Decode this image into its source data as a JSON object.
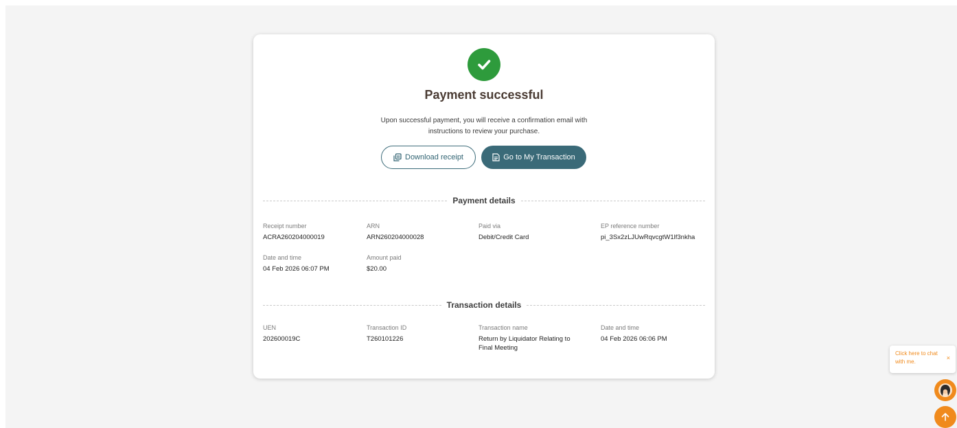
{
  "header": {
    "title": "Payment successful",
    "message": "Upon successful payment, you will receive a confirmation email with instructions to review your purchase."
  },
  "actions": {
    "download_label": "Download receipt",
    "transaction_label": "Go to My Transaction"
  },
  "payment_details": {
    "heading": "Payment details",
    "receipt_number": {
      "label": "Receipt number",
      "value": "ACRA260204000019"
    },
    "arn": {
      "label": "ARN",
      "value": "ARN260204000028"
    },
    "paid_via": {
      "label": "Paid via",
      "value": "Debit/Credit Card"
    },
    "ep_reference": {
      "label": "EP reference number",
      "value": "pi_3Sx2zLJUwRqvcgtW1lf3nkha"
    },
    "date_time": {
      "label": "Date and time",
      "value": "04 Feb 2026 06:07 PM"
    },
    "amount_paid": {
      "label": "Amount paid",
      "value": "$20.00"
    }
  },
  "transaction_details": {
    "heading": "Transaction details",
    "uen": {
      "label": "UEN",
      "value": "202600019C"
    },
    "transaction_id": {
      "label": "Transaction ID",
      "value": "T260101226"
    },
    "transaction_name": {
      "label": "Transaction name",
      "value": "Return by Liquidator Relating to Final Meeting"
    },
    "date_time": {
      "label": "Date and time",
      "value": "04 Feb 2026 06:06 PM"
    }
  },
  "chat": {
    "prompt": "Click here to chat with me.",
    "close": "×"
  },
  "colors": {
    "success": "#2e9b3c",
    "primary": "#3a6a78",
    "accent": "#f08a1c"
  },
  "icons": {
    "success": "check-circle-icon",
    "download": "copy-icon",
    "transaction": "document-icon",
    "chat": "avatar-icon",
    "scroll_top": "arrow-up-icon"
  }
}
